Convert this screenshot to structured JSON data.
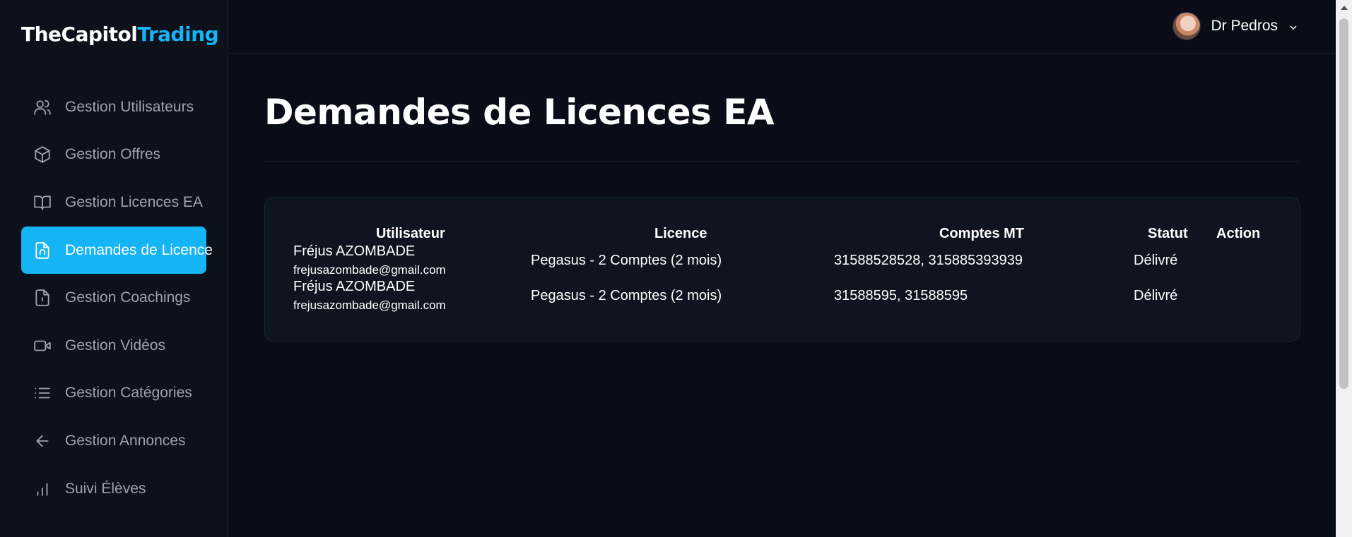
{
  "logo": {
    "part1": "TheCapitol",
    "part2": "Trading"
  },
  "sidebar": {
    "items": [
      {
        "label": "Gestion Utilisateurs",
        "icon": "users-icon"
      },
      {
        "label": "Gestion Offres",
        "icon": "package-icon"
      },
      {
        "label": "Gestion Licences EA",
        "icon": "book-icon"
      },
      {
        "label": "Demandes de Licence",
        "icon": "file-request-icon",
        "active": true
      },
      {
        "label": "Gestion Coachings",
        "icon": "file-icon"
      },
      {
        "label": "Gestion Vidéos",
        "icon": "video-icon"
      },
      {
        "label": "Gestion Catégories",
        "icon": "list-icon"
      },
      {
        "label": "Gestion Annonces",
        "icon": "arrow-left-icon"
      },
      {
        "label": "Suivi Élèves",
        "icon": "bar-chart-icon"
      }
    ]
  },
  "header": {
    "user_name": "Dr Pedros"
  },
  "page": {
    "title": "Demandes de Licences EA"
  },
  "table": {
    "columns": [
      "Utilisateur",
      "Licence",
      "Comptes MT",
      "Statut",
      "Action"
    ],
    "rows": [
      {
        "name": "Fréjus AZOMBADE",
        "email": "frejusazombade@gmail.com",
        "licence": "Pegasus - 2 Comptes (2 mois)",
        "comptes": "31588528528, 315885393939",
        "statut": "Délivré"
      },
      {
        "name": "Fréjus AZOMBADE",
        "email": "frejusazombade@gmail.com",
        "licence": "Pegasus - 2 Comptes (2 mois)",
        "comptes": "31588595, 31588595",
        "statut": "Délivré"
      }
    ]
  },
  "colors": {
    "accent": "#14b4f5",
    "background": "#0a0d17",
    "sidebar": "#0c111c"
  }
}
